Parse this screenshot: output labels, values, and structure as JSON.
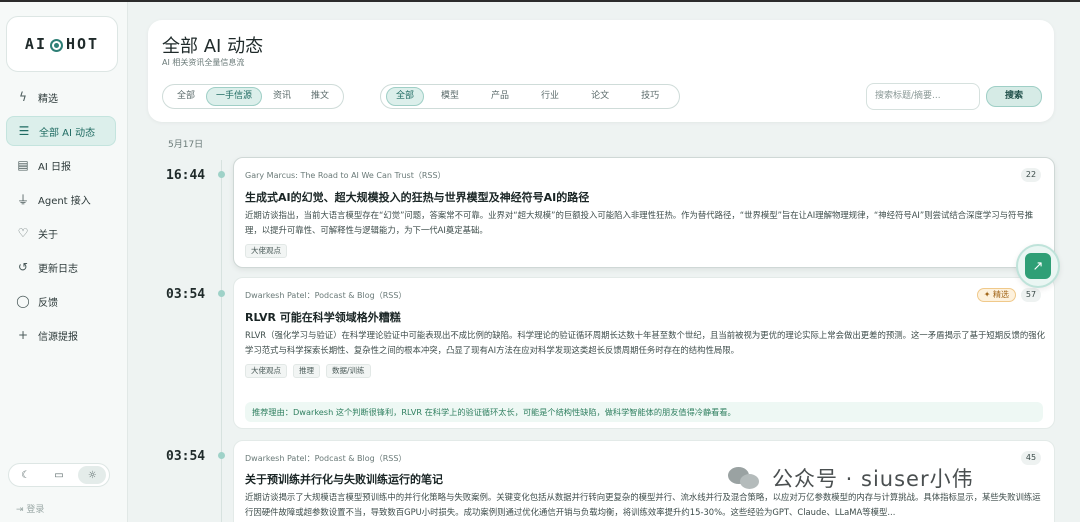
{
  "app": {
    "logo_left": "AI",
    "logo_right": "HOT"
  },
  "sidebar": {
    "items": [
      {
        "label": "精选",
        "icon": "lightning-icon"
      },
      {
        "label": "全部 AI 动态",
        "icon": "list-icon",
        "active": true
      },
      {
        "label": "AI 日报",
        "icon": "document-icon"
      },
      {
        "label": "Agent 接入",
        "icon": "plug-icon"
      },
      {
        "label": "关于",
        "icon": "heart-icon"
      },
      {
        "label": "更新日志",
        "icon": "history-icon"
      },
      {
        "label": "反馈",
        "icon": "chat-icon"
      },
      {
        "label": "信源提报",
        "icon": "plus-icon"
      }
    ],
    "theme": [
      "☾",
      "▭",
      "☼"
    ],
    "login": "登录"
  },
  "header": {
    "title": "全部 AI 动态",
    "subtitle": "AI 相关资讯全量信息流",
    "source_filters": [
      "全部",
      "一手信源",
      "资讯",
      "推文"
    ],
    "source_active": 1,
    "category_filters": [
      "全部",
      "模型",
      "产品",
      "行业",
      "论文",
      "技巧"
    ],
    "category_active": 0,
    "search_placeholder": "搜索标题/摘要...",
    "search_button": "搜索"
  },
  "feed": {
    "date": "5月17日",
    "items": [
      {
        "time": "16:44",
        "source": "Gary Marcus: The Road to AI We Can Trust（RSS）",
        "count": "22",
        "title": "生成式AI的幻觉、超大规模投入的狂热与世界模型及神经符号AI的路径",
        "summary": "近期访谈指出，当前大语言模型存在“幻觉”问题，答案常不可靠。业界对“超大规模”的巨额投入可能陷入非理性狂热。作为替代路径，“世界模型”旨在让AI理解物理规律，“神经符号AI”则尝试结合深度学习与符号推理，以提升可靠性、可解释性与逻辑能力，为下一代AI奠定基础。",
        "tags": [
          "大佬观点"
        ]
      },
      {
        "time": "03:54",
        "source": "Dwarkesh Patel：Podcast & Blog（RSS）",
        "featured": "✦ 精选",
        "count": "57",
        "title": "RLVR 可能在科学领域格外糟糕",
        "summary": "RLVR（强化学习与验证）在科学理论验证中可能表现出不成比例的缺陷。科学理论的验证循环周期长达数十年甚至数个世纪，且当前被视为更优的理论实际上常会做出更差的预测。这一矛盾揭示了基于短期反馈的强化学习范式与科学探索长期性、复杂性之间的根本冲突，凸显了现有AI方法在应对科学发现这类超长反馈周期任务时存在的结构性局限。",
        "tags": [
          "大佬观点",
          "推理",
          "数据/训练"
        ],
        "reason": "推荐理由：Dwarkesh 这个判断很锋利，RLVR 在科学上的验证循环太长，可能是个结构性缺陷，做科学智能体的朋友值得冷静看看。"
      },
      {
        "time": "03:54",
        "source": "Dwarkesh Patel：Podcast & Blog（RSS）",
        "count": "45",
        "title": "关于预训练并行化与失败训练运行的笔记",
        "summary": "近期访谈揭示了大规模语言模型预训练中的并行化策略与失败案例。关键变化包括从数据并行转向更复杂的模型并行、流水线并行及混合策略，以应对万亿参数模型的内存与计算挑战。具体指标显示，某些失败训练运行因硬件故障或超参数设置不当，导致数百GPU小时损失。成功案例则通过优化通信开销与负载均衡，将训练效率提升约15-30%。这些经验为GPT、Claude、LLaMA等模型..."
      }
    ]
  },
  "watermark": {
    "text": "公众号 · siuser小伟"
  }
}
